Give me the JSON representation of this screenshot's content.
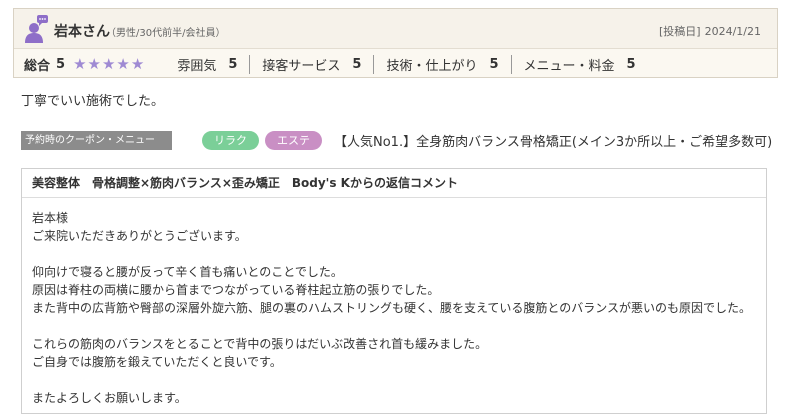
{
  "reviewer": {
    "name": "岩本さん",
    "meta": "（男性/30代前半/会社員）"
  },
  "post": {
    "date_label": "[投稿日]",
    "date": "2024/1/21"
  },
  "ratings": {
    "overall_label": "総合",
    "overall_score": "5",
    "stars": "★★★★★",
    "overall_value": 5,
    "overall_max": 5,
    "categories": [
      {
        "label": "雰囲気",
        "score": "5"
      },
      {
        "label": "接客サービス",
        "score": "5"
      },
      {
        "label": "技術・仕上がり",
        "score": "5"
      },
      {
        "label": "メニュー・料金",
        "score": "5"
      }
    ]
  },
  "review": {
    "text": "丁寧でいい施術でした。"
  },
  "coupon": {
    "label": "予約時のクーポン・メニュー",
    "tags": [
      "リラク",
      "エステ"
    ],
    "menu": "【人気No1.】全身筋肉バランス骨格矯正(メイン3か所以上・ご希望多数可)"
  },
  "reply": {
    "title": "美容整体　骨格調整×筋肉バランス×歪み矯正　Body's Kからの返信コメント",
    "lines": [
      "岩本様",
      "ご来院いただきありがとうございます。",
      "",
      "仰向けで寝ると腰が反って辛く首も痛いとのことでした。",
      "原因は脊柱の両横に腰から首までつながっている脊柱起立筋の張りでした。",
      "また背中の広背筋や臀部の深層外旋六筋、腿の裏のハムストリングも硬く、腰を支えている腹筋とのバランスが悪いのも原因でした。",
      "",
      "これらの筋肉のバランスをとることで背中の張りはだいぶ改善され首も緩みました。",
      "ご自身では腹筋を鍛えていただくと良いです。",
      "",
      "またよろしくお願いします。"
    ]
  },
  "colors": {
    "star": "#9f8ad3",
    "avatar": "#8e6ec8",
    "tag_relax": "#7bcf98",
    "tag_esthe": "#c98fc4",
    "coupon_label_bg": "#8c8c8c"
  }
}
